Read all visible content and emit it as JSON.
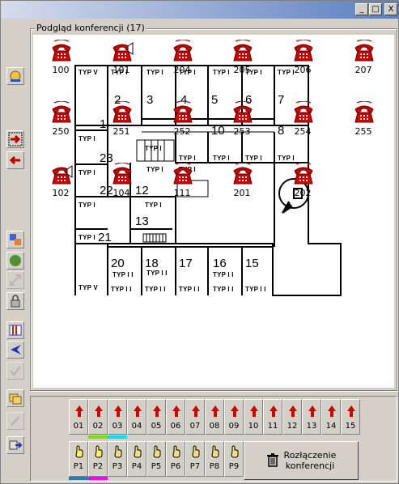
{
  "window": {
    "title": ""
  },
  "window_controls": {
    "minimize": "_",
    "maximize": "□",
    "close": "X"
  },
  "panel": {
    "title": "Podgląd konferencji (17)"
  },
  "left_toolbar": [
    {
      "name": "alarm-bell-icon"
    },
    {
      "name": "forward-arrow-icon"
    },
    {
      "name": "back-arrow-icon"
    },
    {
      "name": "copy-tree-icon"
    },
    {
      "name": "globe-icon"
    },
    {
      "name": "resize-icon"
    },
    {
      "name": "lock-icon"
    },
    {
      "name": "columns-icon"
    },
    {
      "name": "left-arrow-icon"
    },
    {
      "name": "checkmark-icon"
    },
    {
      "name": "folders-icon"
    },
    {
      "name": "pencil-icon"
    },
    {
      "name": "exit-icon"
    }
  ],
  "phones": [
    {
      "label": "100",
      "state": "ringing"
    },
    {
      "label": "101",
      "state": "speaking"
    },
    {
      "label": "204",
      "state": "ringing"
    },
    {
      "label": "205",
      "state": "ringing"
    },
    {
      "label": "206",
      "state": "ringing"
    },
    {
      "label": "207",
      "state": "ringing"
    },
    {
      "label": "250",
      "state": "ringing"
    },
    {
      "label": "251",
      "state": "ringing"
    },
    {
      "label": "252",
      "state": "ringing"
    },
    {
      "label": "253",
      "state": "ringing"
    },
    {
      "label": "254",
      "state": "ringing"
    },
    {
      "label": "255",
      "state": "ringing"
    },
    {
      "label": "102",
      "state": "speaking"
    },
    {
      "label": "104",
      "state": "ringing"
    },
    {
      "label": "111",
      "state": "ringing"
    },
    {
      "label": "201",
      "state": "ringing"
    },
    {
      "label": "202",
      "state": "ringing"
    }
  ],
  "floor_plan": {
    "rooms": [
      "1",
      "2",
      "3",
      "4",
      "5",
      "6",
      "7",
      "8",
      "10",
      "12",
      "13",
      "15",
      "16",
      "17",
      "18",
      "20",
      "21",
      "22",
      "23"
    ],
    "typ_labels": [
      "TYP V",
      "TYP I",
      "TYP I",
      "TYP I",
      "TYP I",
      "TYP I",
      "TYP I",
      "TYP I",
      "TYP I",
      "TYP I",
      "TYP I",
      "TYP I",
      "TYP I",
      "TYP I",
      "TYP I",
      "TYP I",
      "TYP I",
      "TYP I",
      "TYP I",
      "TYP V",
      "TYP I I",
      "TYP I I",
      "TYP I I",
      "TYP I I",
      "TYP I I",
      "TYP I I",
      "TYP I I",
      "TYP I I"
    ]
  },
  "tracks": [
    {
      "label": "01"
    },
    {
      "label": "02",
      "strip": "#7fe000"
    },
    {
      "label": "03",
      "strip": "#00e0ff"
    },
    {
      "label": "04"
    },
    {
      "label": "05"
    },
    {
      "label": "06"
    },
    {
      "label": "07"
    },
    {
      "label": "08"
    },
    {
      "label": "09"
    },
    {
      "label": "10"
    },
    {
      "label": "11"
    },
    {
      "label": "12"
    },
    {
      "label": "13"
    },
    {
      "label": "14"
    },
    {
      "label": "15"
    }
  ],
  "presets": [
    {
      "label": "P1",
      "strip": "#1e7fc0",
      "active": true
    },
    {
      "label": "P2",
      "strip": "#ff00ff",
      "active": true
    },
    {
      "label": "P3"
    },
    {
      "label": "P4"
    },
    {
      "label": "P5"
    },
    {
      "label": "P6"
    },
    {
      "label": "P7"
    },
    {
      "label": "P8"
    },
    {
      "label": "P9"
    }
  ],
  "disconnect_button": {
    "line1": "Rozłączenie",
    "line2": "konferencji"
  }
}
